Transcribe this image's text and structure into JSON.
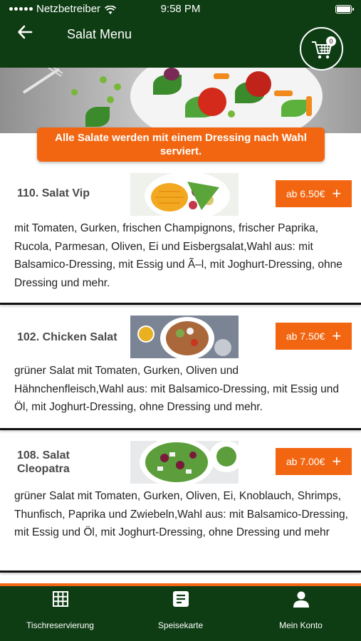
{
  "status_bar": {
    "carrier": "Netzbetreiber",
    "time": "9:58 PM"
  },
  "header": {
    "title": "Salat Menu",
    "cart_count": "0"
  },
  "notice": "Alle Salate werden mit einem Dressing nach Wahl serviert.",
  "items": [
    {
      "name": "110. Salat Vip",
      "price": "ab 6.50€",
      "description": "mit Tomaten, Gurken, frischen Champignons, frischer Paprika, Rucola, Parmesan, Oliven, Ei und Eisbergsalat,Wahl aus: mit Balsamico-Dressing, mit Essig und Ã–l, mit Joghurt-Dressing, ohne Dressing und mehr."
    },
    {
      "name": "102. Chicken Salat",
      "price": "ab 7.50€",
      "description": "grüner Salat mit Tomaten, Gurken, Oliven und Hähnchenfleisch,Wahl aus: mit Balsamico-Dressing, mit Essig und Öl, mit Joghurt-Dressing, ohne Dressing und mehr."
    },
    {
      "name": "108. Salat Cleopatra",
      "price": "ab 7.00€",
      "description": "grüner Salat mit Tomaten, Gurken, Oliven, Ei, Knoblauch, Shrimps, Thunfisch, Paprika und Zwiebeln,Wahl aus: mit Balsamico-Dressing, mit Essig und Öl, mit Joghurt-Dressing, ohne Dressing und mehr"
    }
  ],
  "tabs": [
    {
      "label": "Tischreservierung",
      "icon": "grid-icon"
    },
    {
      "label": "Speisekarte",
      "icon": "menu-document-icon"
    },
    {
      "label": "Mein Konto",
      "icon": "person-icon"
    }
  ],
  "colors": {
    "brand_green": "#0e3d14",
    "accent_orange": "#f26611"
  }
}
